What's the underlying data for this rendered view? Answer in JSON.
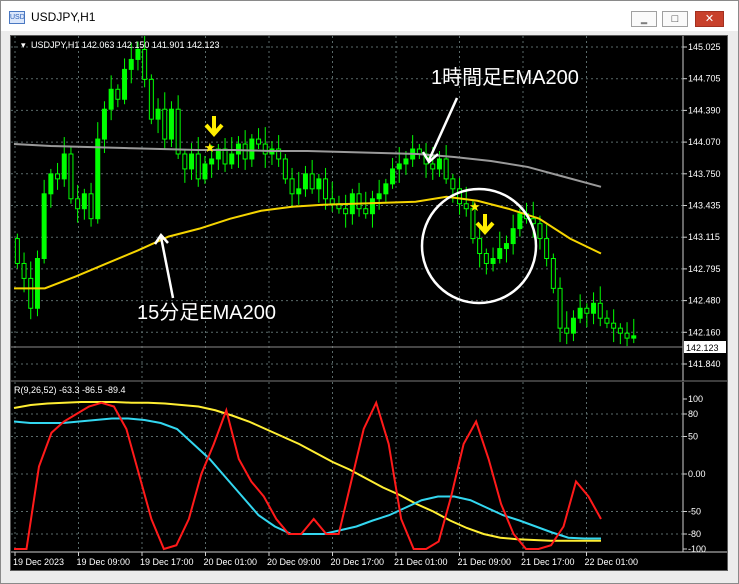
{
  "window": {
    "title": "USDJPY,H1",
    "min_glyph": "‗",
    "max_glyph": "□",
    "close_glyph": "✕",
    "icon_text": "USD"
  },
  "price_chart": {
    "header": "USDJPY,H1  142.063 142.150 141.901 142.123",
    "current_price": "142.123",
    "price_levels": [
      "145.025",
      "144.705",
      "144.390",
      "144.070",
      "143.750",
      "143.435",
      "143.115",
      "142.795",
      "142.480",
      "142.160",
      "141.840"
    ],
    "annotation_ema60": "1時間足EMA200",
    "annotation_ema15": "15分足EMA200",
    "colors": {
      "bull": "#00ff00",
      "bear": "#000000",
      "ema_gray": "#9a9a9a",
      "ema_yellow": "#f5d400",
      "arrow": "#ffff00"
    }
  },
  "indicator": {
    "header": "R(9,26,52) -63.3 -86.5 -89.4",
    "levels": [
      "100",
      "80",
      "50",
      "0.00",
      "-50",
      "-80",
      "-100"
    ],
    "colors": {
      "fast": "#ff1a1a",
      "mid": "#33d7f0",
      "slow": "#ffee33"
    }
  },
  "time_axis": {
    "labels": [
      "19 Dec 2023",
      "19 Dec 09:00",
      "19 Dec 17:00",
      "20 Dec 01:00",
      "20 Dec 09:00",
      "20 Dec 17:00",
      "21 Dec 01:00",
      "21 Dec 09:00",
      "21 Dec 17:00",
      "22 Dec 01:00"
    ]
  }
}
